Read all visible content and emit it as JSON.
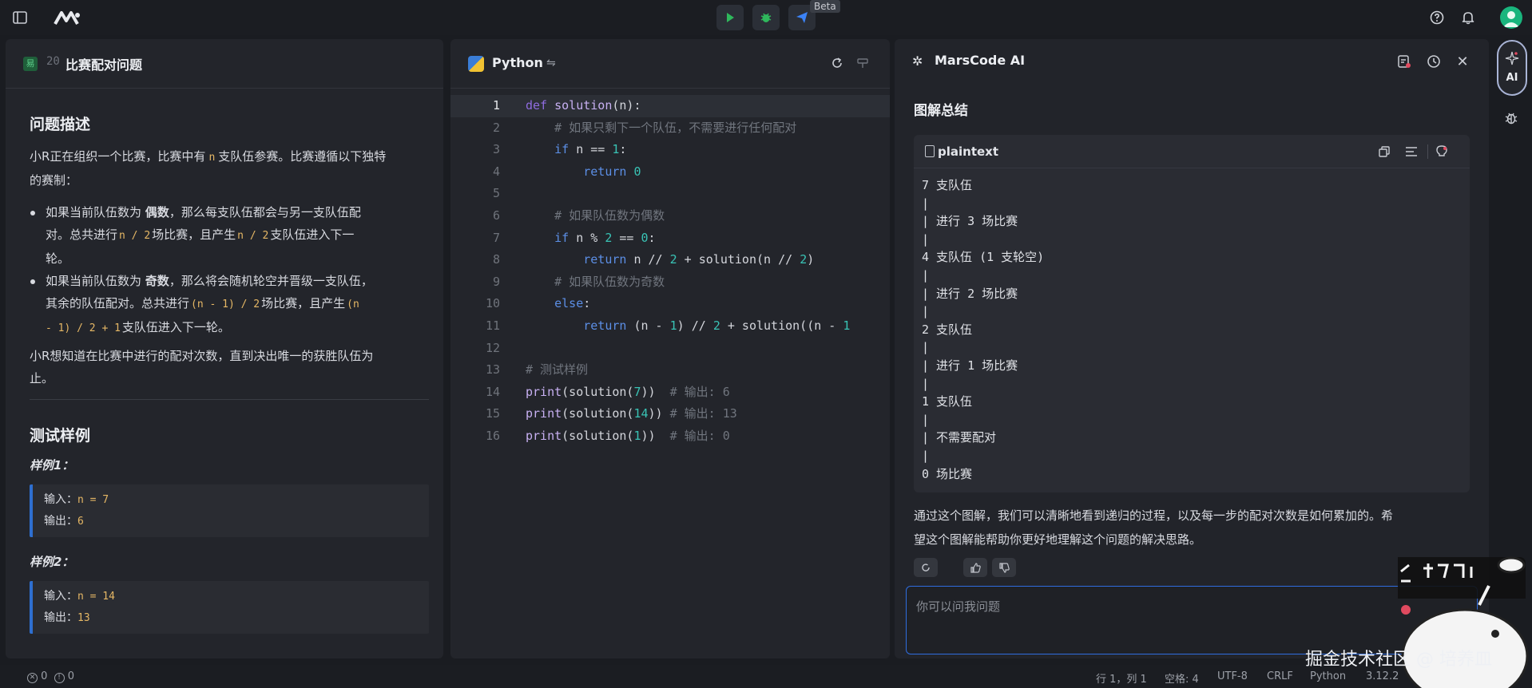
{
  "topbar": {
    "beta_label": "Beta"
  },
  "problem": {
    "difficulty": "易",
    "number": "20",
    "title": "比赛配对问题",
    "desc_heading": "问题描述",
    "desc_p1_a": "小R正在组织一个比赛，比赛中有",
    "desc_p1_code": "n",
    "desc_p1_b": "支队伍参赛。比赛遵循以下独特",
    "desc_p1_c": "的赛制：",
    "b1_a": "如果当前队伍数为",
    "b1_bold": "偶数",
    "b1_b": "，那么每支队伍都会与另一支队伍配",
    "b1_c": "对。总共进行",
    "b1_code1": "n / 2",
    "b1_d": "场比赛，且产生",
    "b1_code2": "n / 2",
    "b1_e": "支队伍进入下一",
    "b1_f": "轮。",
    "b2_a": "如果当前队伍数为",
    "b2_bold": "奇数",
    "b2_b": "，那么将会随机轮空并晋级一支队伍，",
    "b2_c": "其余的队伍配对。总共进行",
    "b2_code1": "(n - 1) / 2",
    "b2_d": "场比赛，且产生",
    "b2_code2a": "(n",
    "b2_code2b": "- 1) / 2 + 1",
    "b2_e": "支队伍进入下一轮。",
    "desc_p2_a": "小R想知道在比赛中进行的配对次数，直到决出唯一的获胜队伍为",
    "desc_p2_b": "止。",
    "test_heading": "测试样例",
    "ex1_label": "样例1：",
    "ex1_in_label": "输入：",
    "ex1_in": "n = 7",
    "ex1_out_label": "输出：",
    "ex1_out": "6",
    "ex2_label": "样例2：",
    "ex2_in_label": "输入：",
    "ex2_in": "n = 14",
    "ex2_out_label": "输出：",
    "ex2_out": "13"
  },
  "editor": {
    "language": "Python"
  },
  "ai": {
    "title": "MarsCode AI",
    "section_title": "图解总结",
    "code_lang": "plaintext",
    "plain_lines": [
      "7 支队伍",
      "|",
      "| 进行 3 场比赛",
      "|",
      "4 支队伍 (1 支轮空)",
      "|",
      "| 进行 2 场比赛",
      "|",
      "2 支队伍",
      "|",
      "| 进行 1 场比赛",
      "|",
      "1 支队伍",
      "|",
      "| 不需要配对",
      "|",
      "0 场比赛"
    ],
    "summary_1": "通过这个图解，我们可以清晰地看到递归的过程，以及每一步的配对次数是如何累加的。希",
    "summary_2": "望这个图解能帮助你更好地理解这个问题的解决思路。",
    "ask_placeholder": "你可以问我问题"
  },
  "rail": {
    "ai_label": "AI"
  },
  "status": {
    "errors": "0",
    "warnings": "0",
    "position": "行 1，列 1",
    "spaces": "空格: 4",
    "encoding": "UTF-8",
    "eol": "CRLF",
    "language": "Python",
    "version": "3.12.2"
  },
  "watermark": {
    "text": "掘金技术社区 @ 培养皿"
  }
}
